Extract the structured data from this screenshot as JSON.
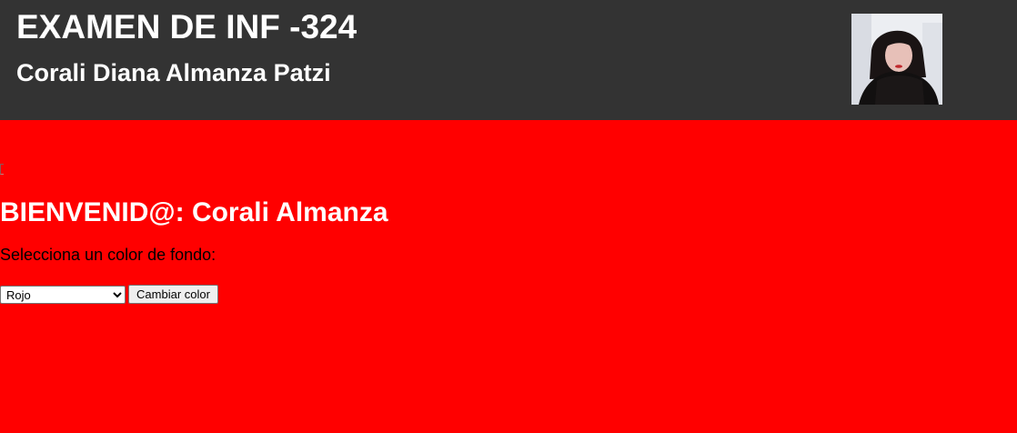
{
  "header": {
    "title": "EXAMEN DE INF -324",
    "subtitle": "Corali Diana Almanza Patzi"
  },
  "main": {
    "welcome": "BIENVENID@: Corali Almanza",
    "prompt": "Selecciona un color de fondo:",
    "color_select": {
      "selected": "Rojo",
      "options": [
        "Rojo"
      ]
    },
    "change_button_label": "Cambiar color"
  },
  "colors": {
    "header_bg": "#333333",
    "page_bg": "#ff0000",
    "header_text": "#ffffff"
  }
}
